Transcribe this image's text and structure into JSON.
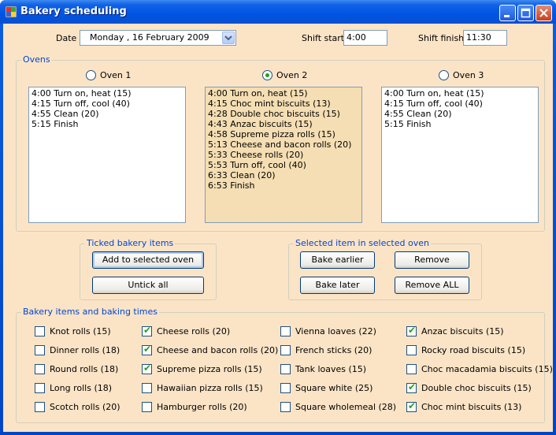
{
  "window": {
    "title": "Bakery scheduling"
  },
  "header": {
    "date_label": "Date",
    "date_value": "Monday   , 16   February   2009",
    "shift_start_label": "Shift start",
    "shift_start_value": "4:00",
    "shift_finish_label": "Shift finish",
    "shift_finish_value": "11:30"
  },
  "ovens": {
    "legend": "Ovens",
    "items": [
      {
        "label": "Oven 1",
        "selected": false,
        "lines": [
          "4:00 Turn on, heat (15)",
          "4:15 Turn off, cool (40)",
          "4:55 Clean (20)",
          "5:15 Finish"
        ]
      },
      {
        "label": "Oven 2",
        "selected": true,
        "lines": [
          "4:00 Turn on, heat (15)",
          "4:15 Choc mint biscuits (13)",
          "4:28 Double choc biscuits (15)",
          "4:43 Anzac biscuits (15)",
          "4:58 Supreme pizza rolls (15)",
          "5:13 Cheese and bacon rolls (20)",
          "5:33 Cheese rolls (20)",
          "5:53 Turn off, cool (40)",
          "6:33 Clean (20)",
          "6:53 Finish"
        ]
      },
      {
        "label": "Oven 3",
        "selected": false,
        "lines": [
          "4:00 Turn on, heat (15)",
          "4:15 Turn off, cool (40)",
          "4:55 Clean (20)",
          "5:15 Finish"
        ]
      }
    ]
  },
  "ticked": {
    "legend": "Ticked bakery items",
    "add_label": "Add to selected oven",
    "untick_label": "Untick all"
  },
  "selected_item": {
    "legend": "Selected item in selected oven",
    "bake_earlier": "Bake earlier",
    "remove": "Remove",
    "bake_later": "Bake later",
    "remove_all": "Remove ALL"
  },
  "items": {
    "legend": "Bakery items and baking times",
    "columns": [
      [
        {
          "label": "Knot rolls (15)",
          "checked": false
        },
        {
          "label": "Dinner rolls (18)",
          "checked": false
        },
        {
          "label": "Round rolls (18)",
          "checked": false
        },
        {
          "label": "Long rolls (18)",
          "checked": false
        },
        {
          "label": "Scotch rolls (20)",
          "checked": false
        }
      ],
      [
        {
          "label": "Cheese rolls (20)",
          "checked": true
        },
        {
          "label": "Cheese and bacon rolls (20)",
          "checked": true
        },
        {
          "label": "Supreme pizza rolls (15)",
          "checked": true
        },
        {
          "label": "Hawaiian pizza rolls (15)",
          "checked": false
        },
        {
          "label": "Hamburger rolls (20)",
          "checked": false
        }
      ],
      [
        {
          "label": "Vienna loaves (22)",
          "checked": false
        },
        {
          "label": "French sticks (20)",
          "checked": false
        },
        {
          "label": "Tank loaves (15)",
          "checked": false
        },
        {
          "label": "Square white (25)",
          "checked": false
        },
        {
          "label": "Square wholemeal (28)",
          "checked": false
        }
      ],
      [
        {
          "label": "Anzac biscuits (15)",
          "checked": true
        },
        {
          "label": "Rocky road biscuits (15)",
          "checked": false
        },
        {
          "label": "Choc macadamia biscuits (15)",
          "checked": false
        },
        {
          "label": "Double choc biscuits (15)",
          "checked": true
        },
        {
          "label": "Choc mint biscuits (13)",
          "checked": true
        }
      ]
    ]
  },
  "colors": {
    "title_bar": "#0054e3",
    "form_background": "#fbe4c6",
    "selected_list_background": "#f5deb3",
    "check_green": "#21a121"
  }
}
